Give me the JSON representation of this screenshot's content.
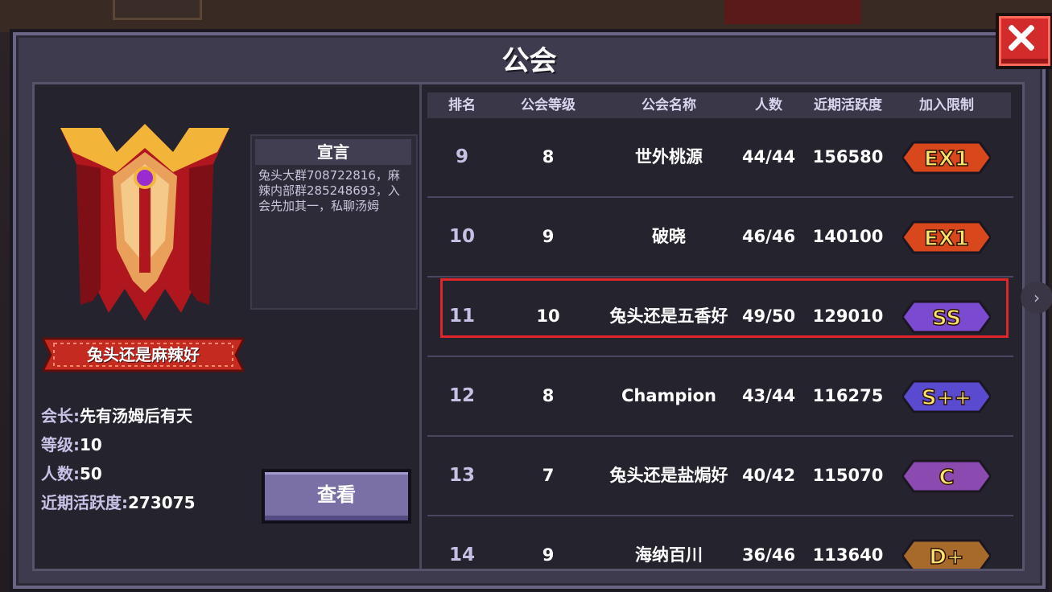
{
  "title": "公会",
  "left": {
    "guild_name": "兔头还是麻辣好",
    "declaration_title": "宣言",
    "declaration": "兔头大群708722816，麻辣内部群285248693，入会先加其一，私聊汤姆",
    "leader_label": "会长:",
    "leader": "先有汤姆后有天",
    "level_label": "等级:",
    "level": "10",
    "members_label": "人数:",
    "members": "50",
    "activity_label": "近期活跃度:",
    "activity": "273075",
    "view_button": "查看"
  },
  "table": {
    "headers": [
      "排名",
      "公会等级",
      "公会名称",
      "人数",
      "近期活跃度",
      "加入限制"
    ],
    "rows": [
      {
        "rank": "9",
        "level": "8",
        "name": "世外桃源",
        "members": "44/44",
        "activity": "156580",
        "limit": "EX1",
        "limit_color": "#d9481c"
      },
      {
        "rank": "10",
        "level": "9",
        "name": "破晓",
        "members": "46/46",
        "activity": "140100",
        "limit": "EX1",
        "limit_color": "#d9481c"
      },
      {
        "rank": "11",
        "level": "10",
        "name": "兔头还是五香好",
        "members": "49/50",
        "activity": "129010",
        "limit": "SS",
        "limit_color": "#7a4ad0"
      },
      {
        "rank": "12",
        "level": "8",
        "name": "Champion",
        "members": "43/44",
        "activity": "116275",
        "limit": "S++",
        "limit_color": "#5a4ad0"
      },
      {
        "rank": "13",
        "level": "7",
        "name": "兔头还是盐焗好",
        "members": "40/42",
        "activity": "115070",
        "limit": "C",
        "limit_color": "#8a4ab0"
      },
      {
        "rank": "14",
        "level": "9",
        "name": "海纳百川",
        "members": "36/46",
        "activity": "113640",
        "limit": "D+",
        "limit_color": "#a86a2a"
      }
    ]
  }
}
